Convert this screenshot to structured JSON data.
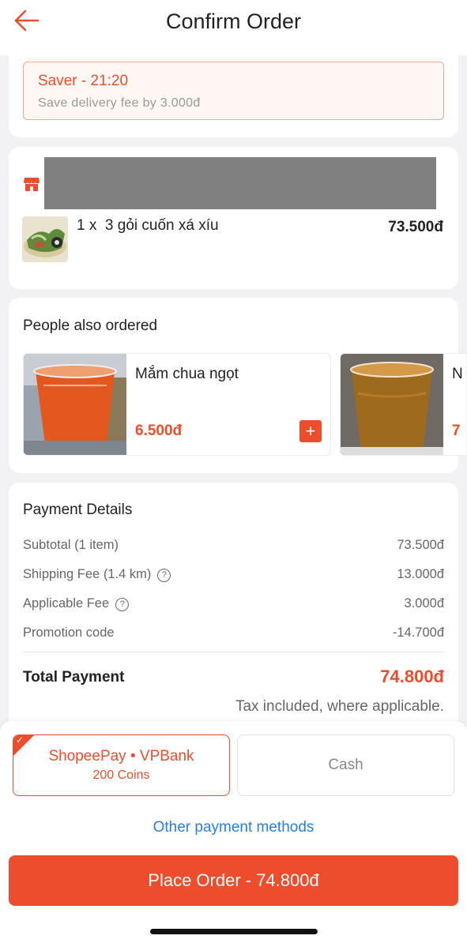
{
  "header": {
    "title": "Confirm Order",
    "back_icon": "arrow-left-icon"
  },
  "saver": {
    "title": "Saver - 21:20",
    "subtitle": "Save delivery fee by 3.000đ"
  },
  "order": {
    "shop_icon": "store-icon",
    "items": [
      {
        "quantity": "1 x",
        "name": "3 gỏi cuốn xá xíu",
        "price": "73.500đ"
      }
    ]
  },
  "recommendations": {
    "title": "People also ordered",
    "items": [
      {
        "name": "Mắm chua ngọt",
        "price": "6.500đ",
        "add_label": "+"
      },
      {
        "name": "N",
        "price": "7",
        "add_label": "+"
      }
    ]
  },
  "payment_details": {
    "title": "Payment Details",
    "rows": [
      {
        "label": "Subtotal (1 item)",
        "value": "73.500đ"
      },
      {
        "label": "Shipping Fee (1.4 km)",
        "value": "13.000đ"
      },
      {
        "label": "Applicable Fee",
        "value": "3.000đ"
      },
      {
        "label": "Promotion code",
        "value": "-14.700đ"
      }
    ],
    "total_label": "Total Payment",
    "total_value": "74.800đ",
    "tax_note": "Tax included, where applicable."
  },
  "payment_methods": {
    "selected": {
      "name": "ShopeePay • VPBank",
      "sub": "200 Coins"
    },
    "cash": {
      "name": "Cash"
    },
    "other_link": "Other payment methods"
  },
  "place_order": {
    "label": "Place Order - 74.800đ"
  },
  "colors": {
    "accent": "#ee4d2d",
    "link": "#2a7de1"
  }
}
